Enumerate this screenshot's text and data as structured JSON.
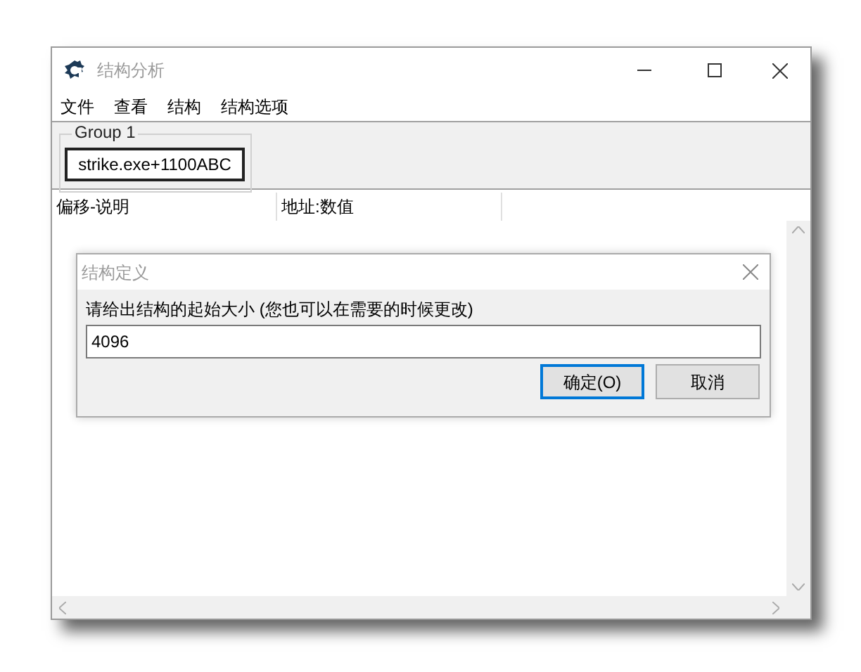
{
  "window": {
    "title": "结构分析"
  },
  "menu": [
    "文件",
    "查看",
    "结构",
    "结构选项"
  ],
  "group": {
    "title": "Group 1",
    "address": "strike.exe+1100ABC"
  },
  "columns": [
    "偏移-说明",
    "地址:数值"
  ],
  "dialog": {
    "title": "结构定义",
    "prompt": "请给出结构的起始大小 (您也可以在需要的时候更改)",
    "value": "4096",
    "buttons": [
      {
        "label": "确定(O)",
        "default": true
      },
      {
        "label": "取消",
        "default": false
      }
    ]
  }
}
